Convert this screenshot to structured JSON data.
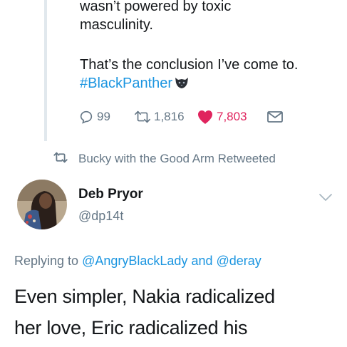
{
  "quoted_tweet": {
    "line1": "wasn’t powered by toxic",
    "line2": "masculinity.",
    "line3": "That’s the conclusion I’ve come to.",
    "hashtag": "#BlackPanther",
    "emoji_icon": "black-panther-hashflag-icon"
  },
  "actions": {
    "reply_count": "99",
    "retweet_count": "1,816",
    "like_count": "7,803",
    "reply_icon": "comment-icon",
    "retweet_icon": "retweet-icon",
    "like_icon": "heart-icon",
    "dm_icon": "envelope-icon"
  },
  "retweet_banner": {
    "icon": "retweet-icon",
    "text": "Bucky with the Good Arm Retweeted"
  },
  "author": {
    "name": "Deb Pryor",
    "handle": "@dp14t",
    "menu_icon": "chevron-down-icon"
  },
  "reply_context": {
    "prefix": "Replying to",
    "mention1": "@AngryBlackLady",
    "joiner": "and",
    "mention2": "@deray"
  },
  "tweet_body": {
    "line1": "Even simpler, Nakia radicalized",
    "line2": "her love, Eric radicalized his"
  },
  "colors": {
    "link": "#1b95e0",
    "muted": "#657786",
    "like": "#e0245e",
    "text": "#14171a"
  }
}
